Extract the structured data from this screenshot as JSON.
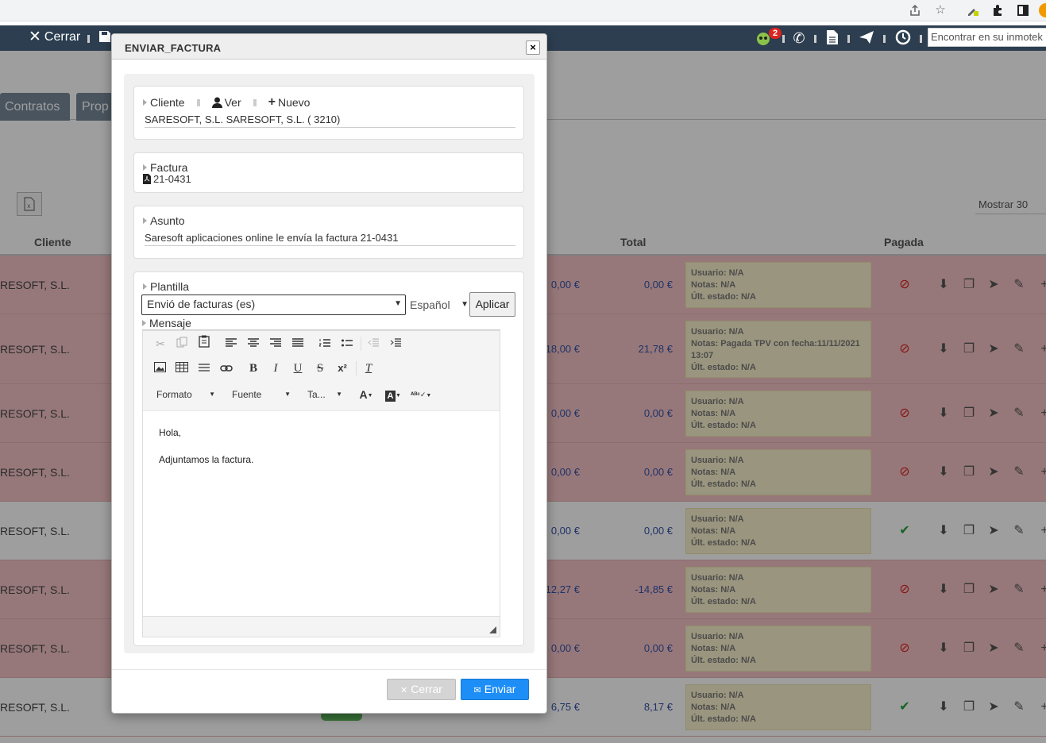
{
  "navbar": {
    "close_label": "Cerrar",
    "badge_count": "2",
    "search_placeholder": "Encontrar en su inmotek"
  },
  "background": {
    "tabs": [
      "Contratos",
      "Prop"
    ],
    "mostrar": "Mostrar 30",
    "excel_label": "x",
    "columns": {
      "cliente": "Cliente",
      "total": "Total",
      "pagada": "Pagada"
    },
    "rows": [
      {
        "cliente": "RESOFT, S.L.",
        "amt1": "0,00 €",
        "amt2": "0,00 €",
        "usuario": "Usuario: N/A",
        "notas": "Notas: N/A",
        "estado": "Últ. estado: N/A",
        "paid": false,
        "color": "red"
      },
      {
        "cliente": "RESOFT, S.L.",
        "amt1": "18,00 €",
        "amt2": "21,78 €",
        "usuario": "Usuario: N/A",
        "notas": "Notas: Pagada TPV con fecha:11/11/2021 13:07",
        "estado": "Últ. estado: N/A",
        "paid": false,
        "color": "red"
      },
      {
        "cliente": "RESOFT, S.L.",
        "amt1": "0,00 €",
        "amt2": "0,00 €",
        "usuario": "Usuario: N/A",
        "notas": "Notas: N/A",
        "estado": "Últ. estado: N/A",
        "paid": false,
        "color": "red"
      },
      {
        "cliente": "RESOFT, S.L.",
        "amt1": "0,00 €",
        "amt2": "0,00 €",
        "usuario": "Usuario: N/A",
        "notas": "Notas: N/A",
        "estado": "Últ. estado: N/A",
        "paid": false,
        "color": "red"
      },
      {
        "cliente": "RESOFT, S.L.",
        "amt1": "0,00 €",
        "amt2": "0,00 €",
        "usuario": "Usuario: N/A",
        "notas": "Notas: N/A",
        "estado": "Últ. estado: N/A",
        "paid": true,
        "color": "white"
      },
      {
        "cliente": "RESOFT, S.L.",
        "amt1": "12,27 €",
        "amt2": "-14,85 €",
        "usuario": "Usuario: N/A",
        "notas": "Notas: N/A",
        "estado": "Últ. estado: N/A",
        "paid": false,
        "color": "red"
      },
      {
        "cliente": "RESOFT, S.L.",
        "amt1": "0,00 €",
        "amt2": "0,00 €",
        "usuario": "Usuario: N/A",
        "notas": "Notas: N/A",
        "estado": "Últ. estado: N/A",
        "paid": false,
        "color": "red"
      },
      {
        "cliente": "RESOFT, S.L.",
        "amt1": "6,75 €",
        "amt2": "8,17 €",
        "usuario": "Usuario: N/A",
        "notas": "Notas: N/A",
        "estado": "Últ. estado: N/A",
        "paid": true,
        "color": "white"
      }
    ]
  },
  "modal": {
    "title": "ENVIAR_FACTURA",
    "close_glyph": "×",
    "cliente": {
      "label": "Cliente",
      "ver_label": "Ver",
      "nuevo_label": "Nuevo",
      "value": "SARESOFT, S.L. SARESOFT, S.L. ( 3210)"
    },
    "factura": {
      "label": "Factura",
      "value": "21-0431"
    },
    "asunto": {
      "label": "Asunto",
      "value": "Saresoft aplicaciones online le envía la factura 21-0431"
    },
    "plantilla": {
      "label": "Plantilla",
      "selected": "Envió de facturas (es)",
      "language": "Español",
      "apply_label": "Aplicar"
    },
    "mensaje": {
      "label": "Mensaje",
      "toolbar": {
        "formato": "Formato",
        "fuente": "Fuente",
        "tamano": "Ta..."
      },
      "content": [
        "Hola,",
        "Adjuntamos la factura."
      ]
    },
    "footer": {
      "cancel_label": "Cerrar",
      "send_label": "Enviar"
    }
  }
}
